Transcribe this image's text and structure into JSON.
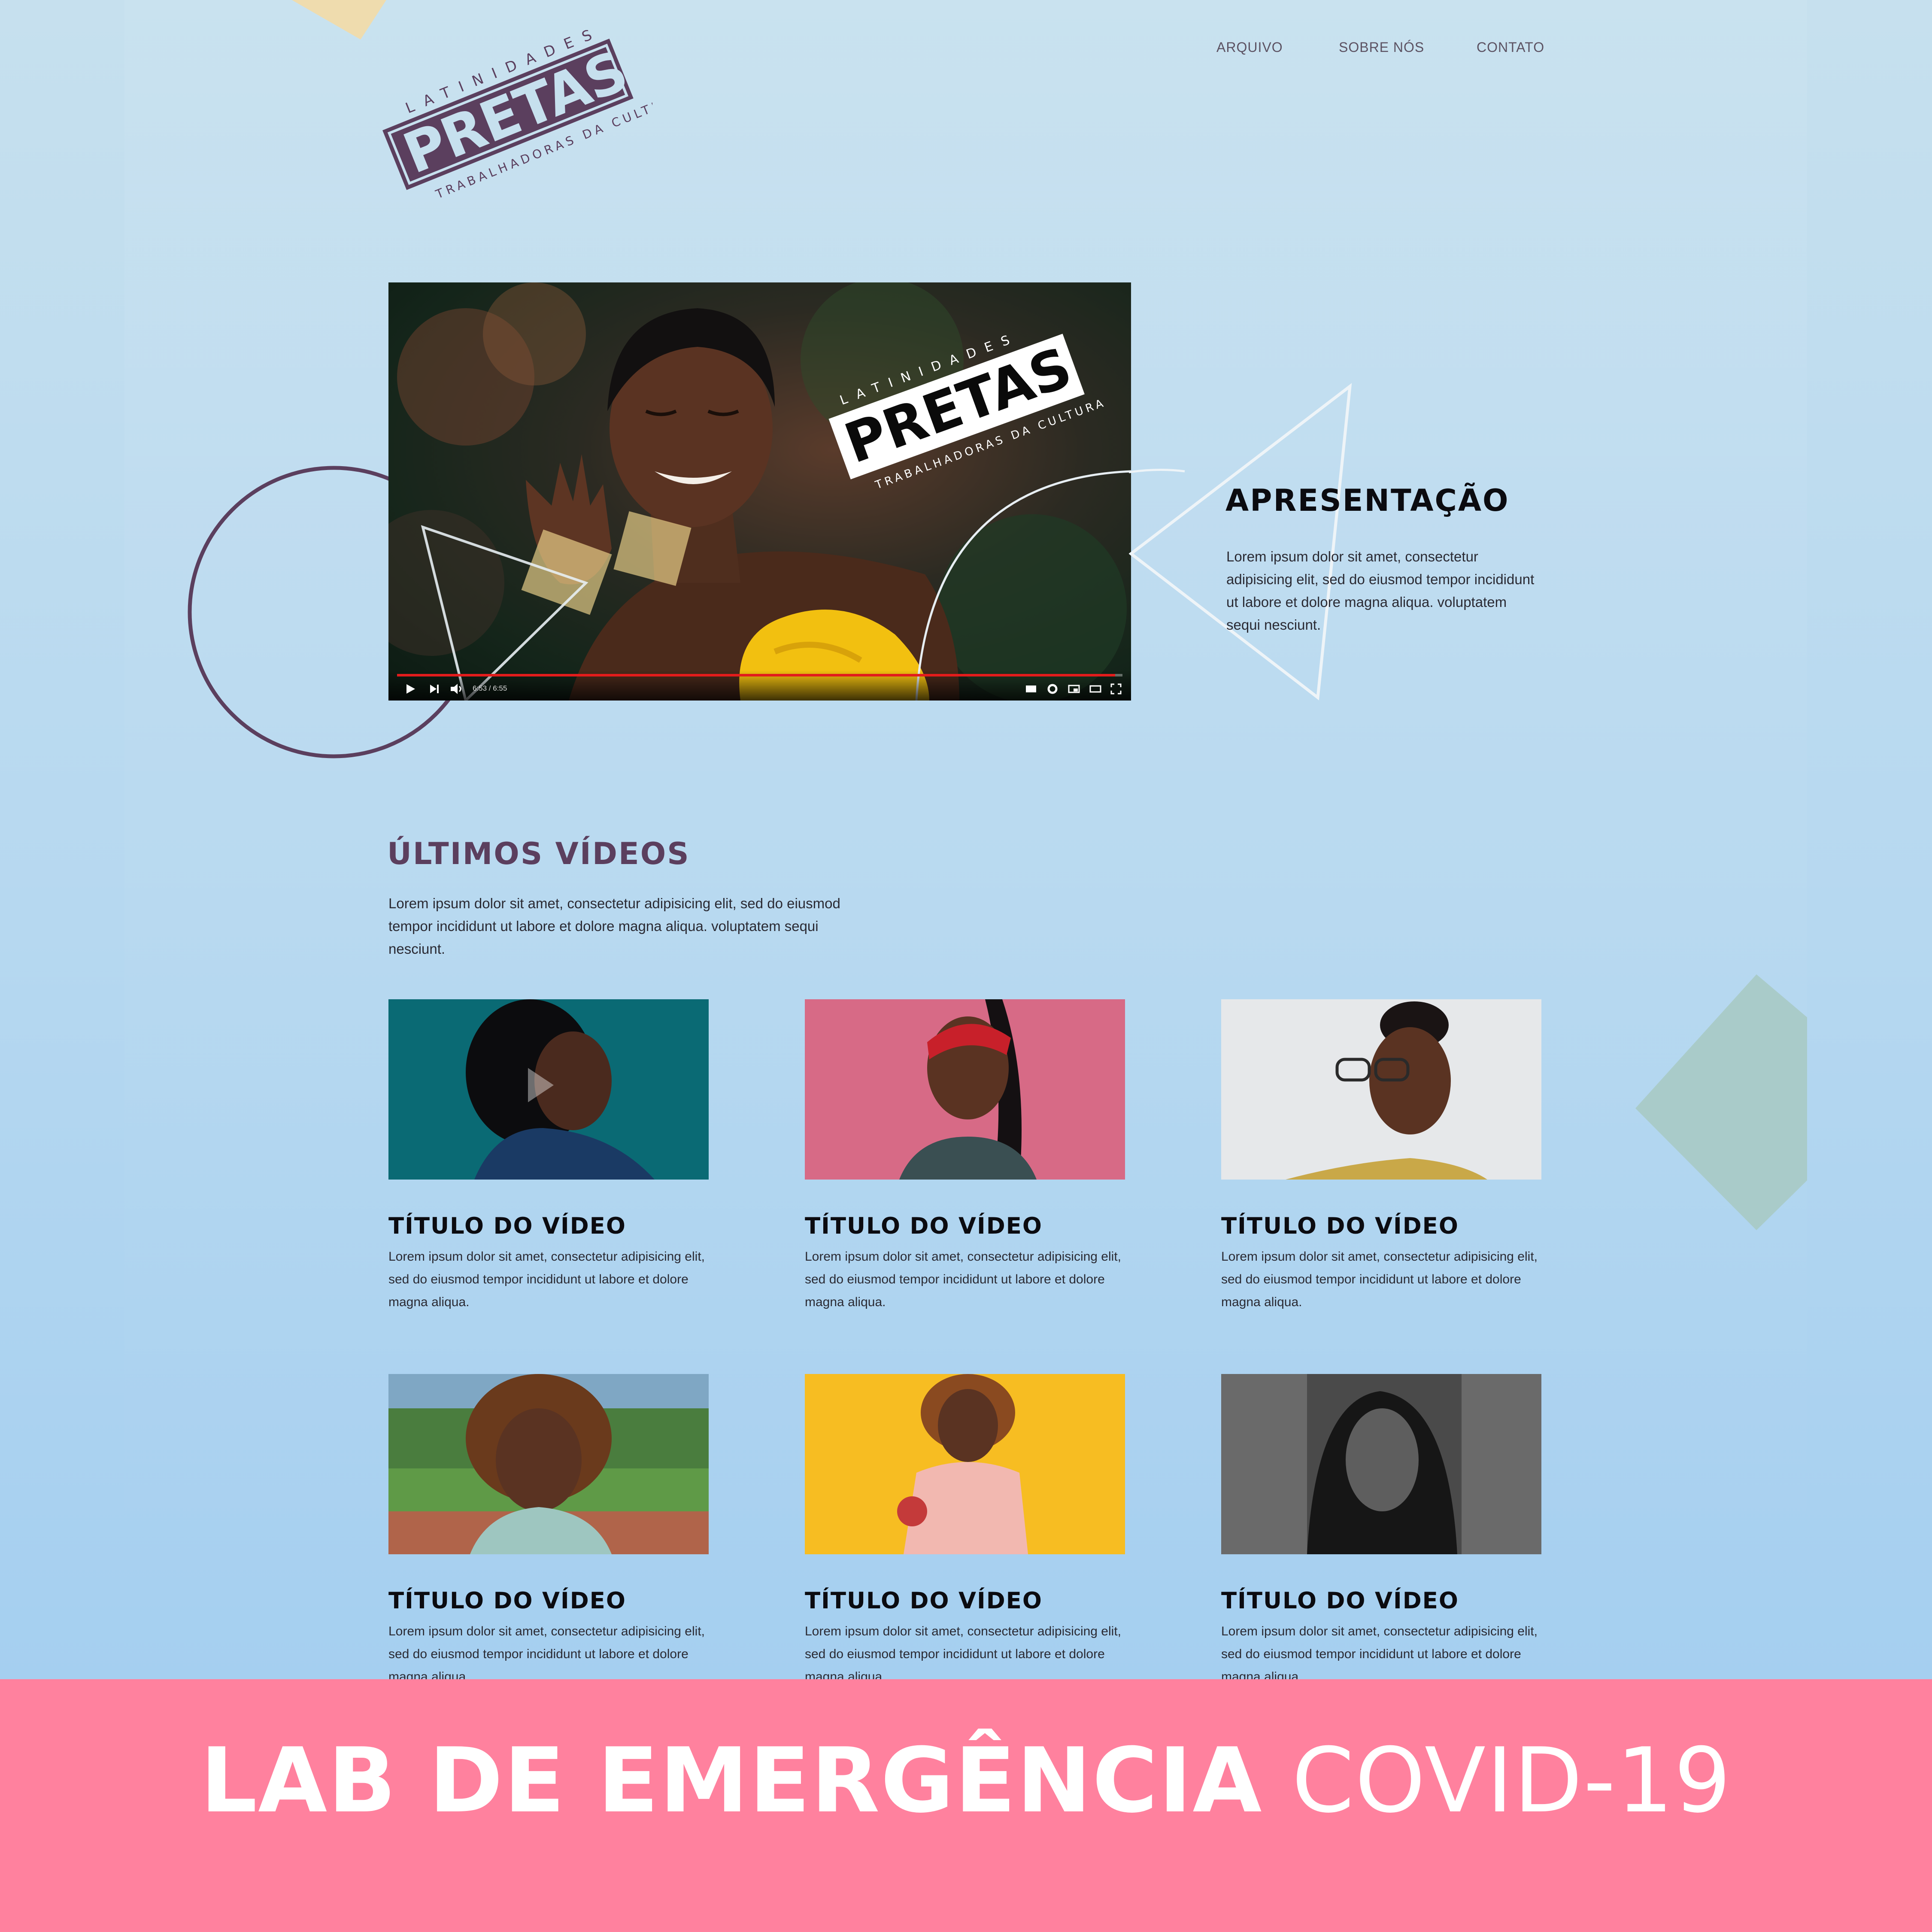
{
  "nav": {
    "items": [
      "ARQUIVO",
      "SOBRE NÓS",
      "CONTATO"
    ]
  },
  "logo": {
    "top": "LATINIDADES",
    "main": "PRETAS",
    "bottom": "TRABALHADORAS DA CULTURA"
  },
  "video": {
    "time": "6:53 / 6:55",
    "progress": 0.99
  },
  "intro": {
    "title": "APRESENTAÇÃO",
    "text": "Lorem ipsum dolor sit amet, consectetur adipisicing elit, sed do eiusmod tempor incididunt ut labore et dolore magna aliqua. voluptatem sequi nesciunt."
  },
  "latest": {
    "title": "ÚLTIMOS VÍDEOS",
    "text": "Lorem ipsum dolor sit amet, consectetur adipisicing elit, sed do eiusmod tempor incididunt ut labore et dolore magna aliqua. voluptatem sequi nesciunt."
  },
  "cards": [
    {
      "title": "TÍTULO DO VÍDEO",
      "text": "Lorem ipsum dolor sit amet, consectetur adipisicing elit, sed do eiusmod tempor incididunt ut labore et dolore magna aliqua."
    },
    {
      "title": "TÍTULO DO VÍDEO",
      "text": "Lorem ipsum dolor sit amet, consectetur adipisicing elit, sed do eiusmod tempor incididunt ut labore et dolore magna aliqua."
    },
    {
      "title": "TÍTULO DO VÍDEO",
      "text": "Lorem ipsum dolor sit amet, consectetur adipisicing elit, sed do eiusmod tempor incididunt ut labore et dolore magna aliqua."
    },
    {
      "title": "TÍTULO DO VÍDEO",
      "text": "Lorem ipsum dolor sit amet, consectetur adipisicing elit, sed do eiusmod tempor incididunt ut labore et dolore magna aliqua."
    },
    {
      "title": "TÍTULO DO VÍDEO",
      "text": "Lorem ipsum dolor sit amet, consectetur adipisicing elit, sed do eiusmod tempor incididunt ut labore et dolore magna aliqua."
    },
    {
      "title": "TÍTULO DO VÍDEO",
      "text": "Lorem ipsum dolor sit amet, consectetur adipisicing elit, sed do eiusmod tempor incididunt ut labore et dolore magna aliqua."
    }
  ],
  "banner": {
    "bold": "LAB DE EMERGÊNCIA",
    "light": "COVID-19"
  },
  "colors": {
    "brand_purple": "#5b3f5e",
    "banner_pink": "#ff819e",
    "accent_yellow": "#f2d98f",
    "accent_teal": "#a9cbc9"
  }
}
